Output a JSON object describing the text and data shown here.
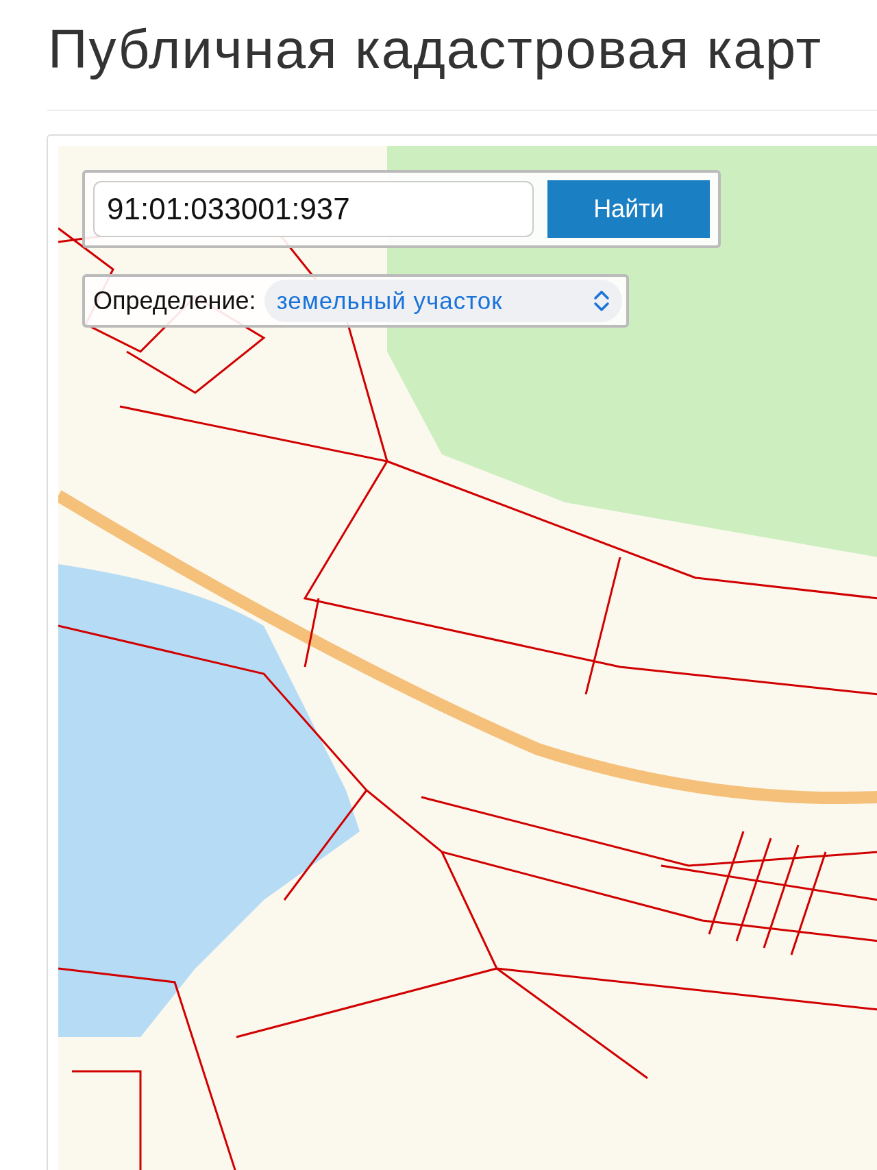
{
  "page": {
    "title": "Публичная кадастровая карт"
  },
  "search": {
    "value": "91:01:033001:937",
    "button": "Найти"
  },
  "definition": {
    "label": "Определение:",
    "value": "земельный участок"
  }
}
